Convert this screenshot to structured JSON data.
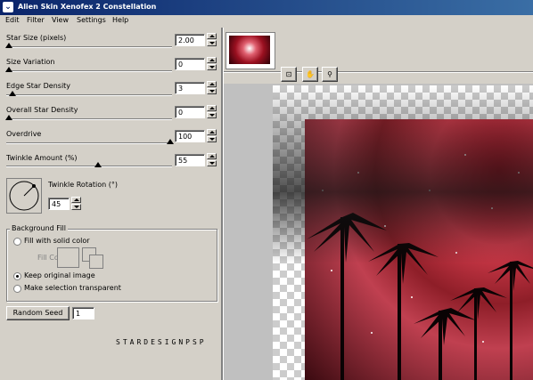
{
  "window": {
    "title": "Alien Skin Xenofex 2 Constellation"
  },
  "menu": [
    "Edit",
    "Filter",
    "View",
    "Settings",
    "Help"
  ],
  "sliders": [
    {
      "label": "Star Size (pixels)",
      "value": "2.00",
      "level": 0.02
    },
    {
      "label": "Size Variation",
      "value": "0",
      "level": 0.0
    },
    {
      "label": "Edge Star Density",
      "value": "3",
      "level": 0.03
    },
    {
      "label": "Overall Star Density",
      "value": "0",
      "level": 0.0
    },
    {
      "label": "Overdrive",
      "value": "100",
      "level": 1.0
    },
    {
      "label": "Twinkle Amount (%)",
      "value": "55",
      "level": 0.55
    }
  ],
  "rotation": {
    "label": "Twinkle Rotation (°)",
    "value": "45"
  },
  "background_fill": {
    "title": "Background Fill",
    "options": [
      {
        "label": "Fill with solid color",
        "selected": false
      },
      {
        "label": "Keep original image",
        "selected": true
      },
      {
        "label": "Make selection transparent",
        "selected": false
      }
    ],
    "fill_color_label": "Fill Color"
  },
  "random_seed": {
    "button_label": "Random Seed",
    "value": "1"
  },
  "watermark": "STARDESIGNPSP",
  "tools": [
    "preview-zoom-fit-icon",
    "hand-icon",
    "magnifier-icon"
  ],
  "colors": {
    "accent": "#0a246a",
    "face": "#d4d0c8"
  }
}
